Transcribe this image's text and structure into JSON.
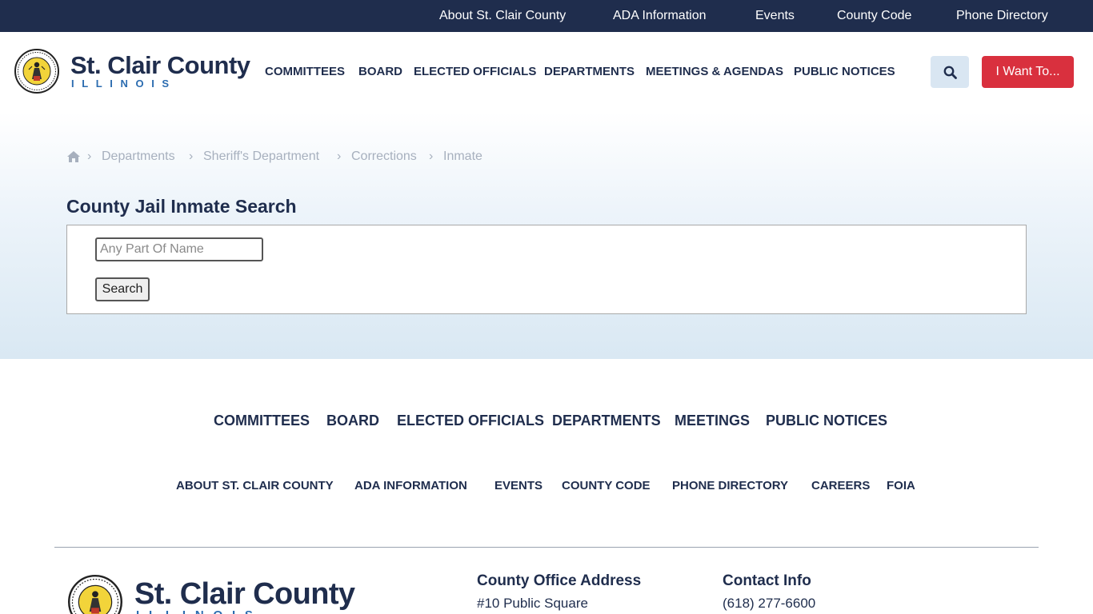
{
  "utility_nav": [
    "About St. Clair County",
    "ADA Information",
    "Events",
    "County Code",
    "Phone Directory"
  ],
  "brand": {
    "name": "St. Clair County",
    "state": "ILLINOIS",
    "seal_text": "COUNTY OF ST. CLAIR"
  },
  "main_nav": [
    "COMMITTEES",
    "BOARD",
    "ELECTED OFFICIALS",
    "DEPARTMENTS",
    "MEETINGS & AGENDAS",
    "PUBLIC NOTICES"
  ],
  "search_icon": "search-icon",
  "i_want_to": "I Want To...",
  "breadcrumb": {
    "home_icon": "home-icon",
    "items": [
      "Departments",
      "Sheriff's Department",
      "Corrections",
      "Inmate"
    ]
  },
  "page_title": "County Jail Inmate Search",
  "inmate_search": {
    "placeholder": "Any Part Of Name",
    "value": "",
    "submit_label": "Search"
  },
  "footer_nav_primary": [
    "COMMITTEES",
    "BOARD",
    "ELECTED OFFICIALS",
    "DEPARTMENTS",
    "MEETINGS",
    "PUBLIC NOTICES"
  ],
  "footer_nav_secondary": [
    "ABOUT ST. CLAIR COUNTY",
    "ADA INFORMATION",
    "EVENTS",
    "COUNTY CODE",
    "PHONE DIRECTORY",
    "CAREERS",
    "FOIA"
  ],
  "footer": {
    "address_heading": "County Office Address",
    "address_line1": "#10 Public Square",
    "contact_heading": "Contact Info",
    "phone": "(618) 277-6600"
  },
  "colors": {
    "navy": "#1f2d4d",
    "accent_red": "#d9303e",
    "accent_blue": "#2b6cb0",
    "light_blue": "#d9e6f2"
  }
}
